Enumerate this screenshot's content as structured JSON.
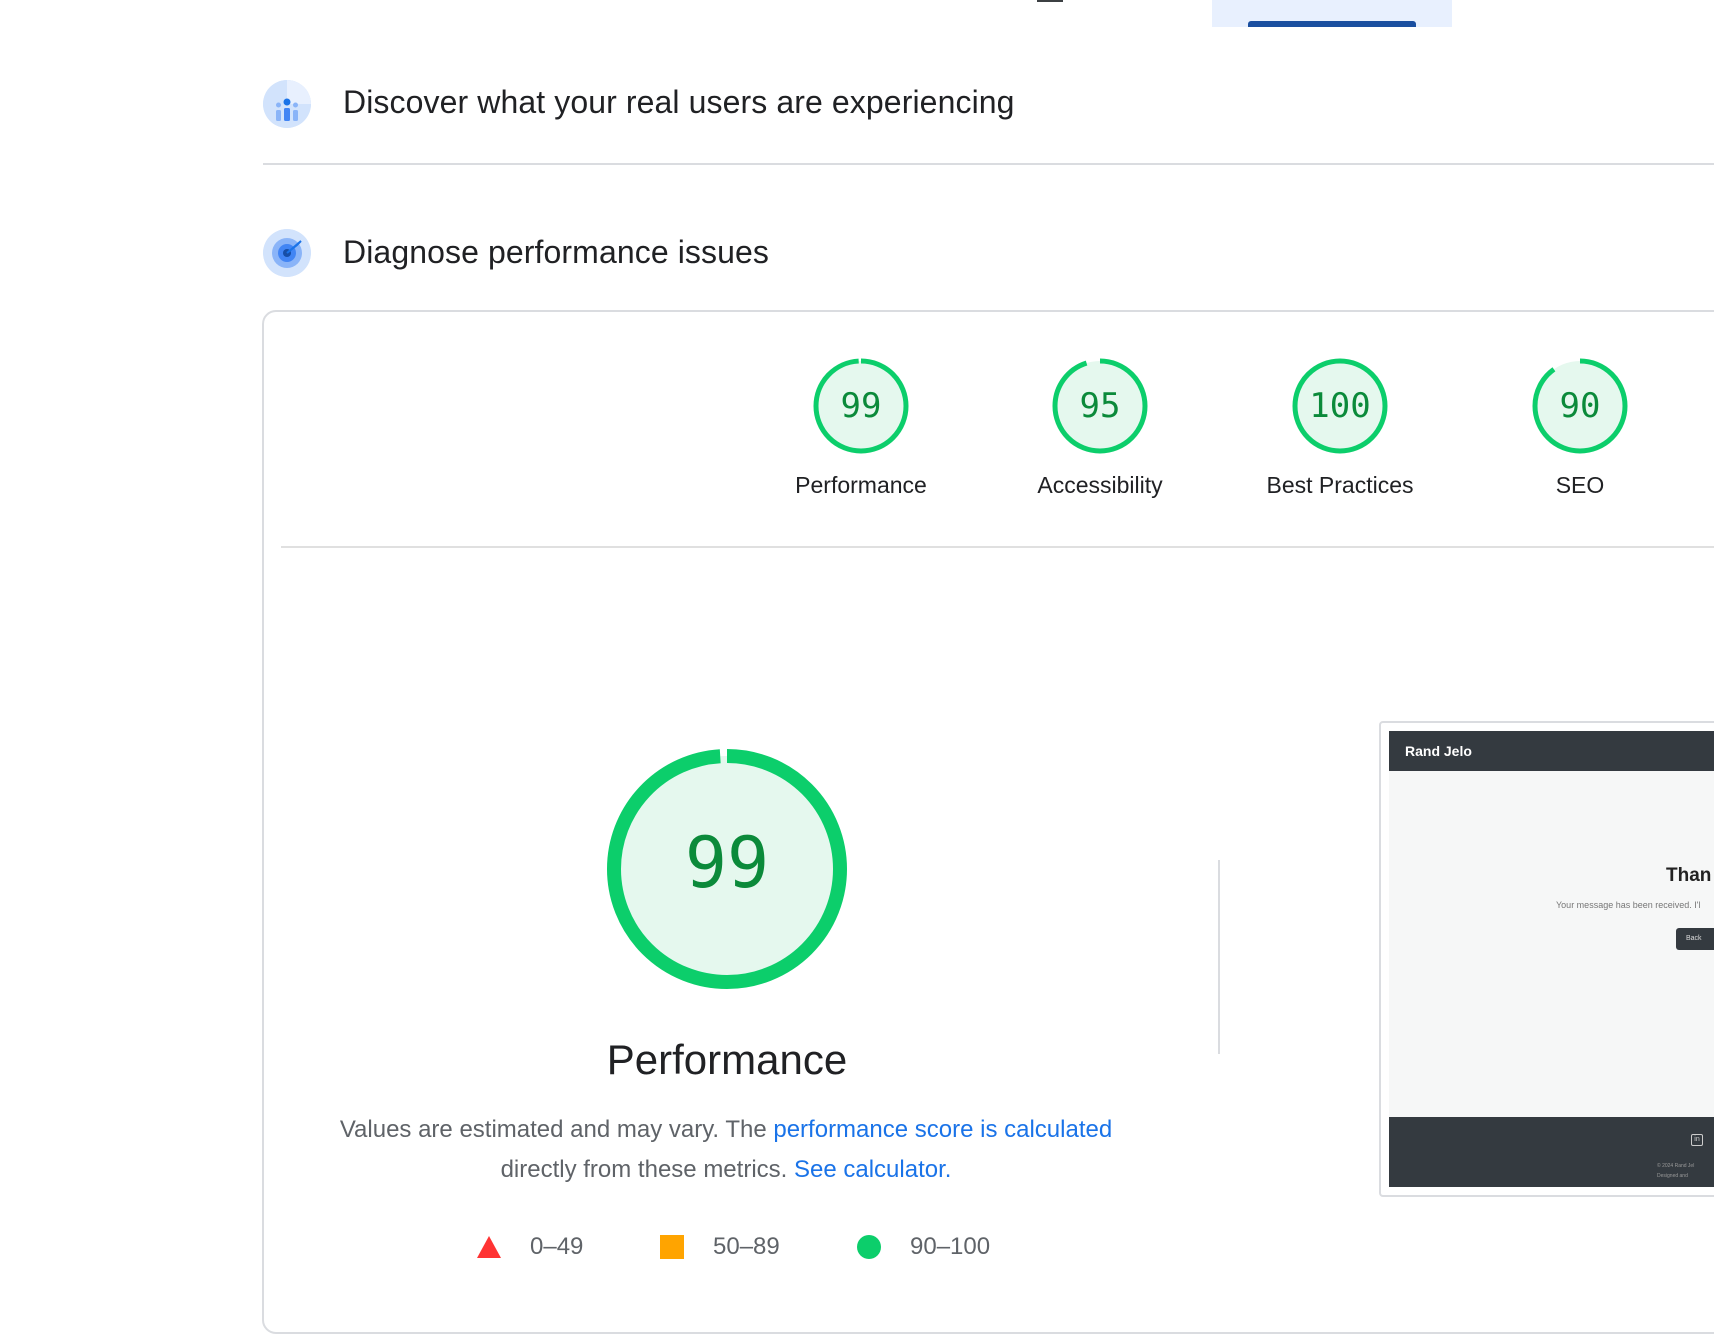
{
  "colors": {
    "pass": "#0cce6b",
    "pass_fill": "#e5f8ee",
    "pass_text": "#0b8a3a",
    "average": "#ffa400",
    "fail": "#ff3333",
    "link": "#1a73e8"
  },
  "sections": {
    "real_users": {
      "title": "Discover what your real users are experiencing",
      "icon": "crux-chart-icon"
    },
    "diagnose": {
      "title": "Diagnose performance issues",
      "icon": "compass-icon"
    }
  },
  "categories": [
    {
      "score": 99,
      "label": "Performance"
    },
    {
      "score": 95,
      "label": "Accessibility"
    },
    {
      "score": 100,
      "label": "Best Practices"
    },
    {
      "score": 90,
      "label": "SEO"
    }
  ],
  "performance": {
    "score": 99,
    "title": "Performance",
    "desc_prefix": "Values are estimated and may vary. The ",
    "desc_link": "performance score is calculated",
    "desc_middle": " directly from these metrics. ",
    "calc_link": "See calculator."
  },
  "legend": [
    {
      "range": "0–49",
      "icon": "triangle-fail-icon"
    },
    {
      "range": "50–89",
      "icon": "square-average-icon"
    },
    {
      "range": "90–100",
      "icon": "circle-pass-icon"
    }
  ],
  "screenshot": {
    "brand": "Rand Jelo",
    "heading": "Than",
    "message": "Your message has been received. I'l",
    "button": "Back",
    "footer_icon": "in",
    "copyright_1": "© 2024 Rand Jel",
    "copyright_2": "Designed and"
  }
}
